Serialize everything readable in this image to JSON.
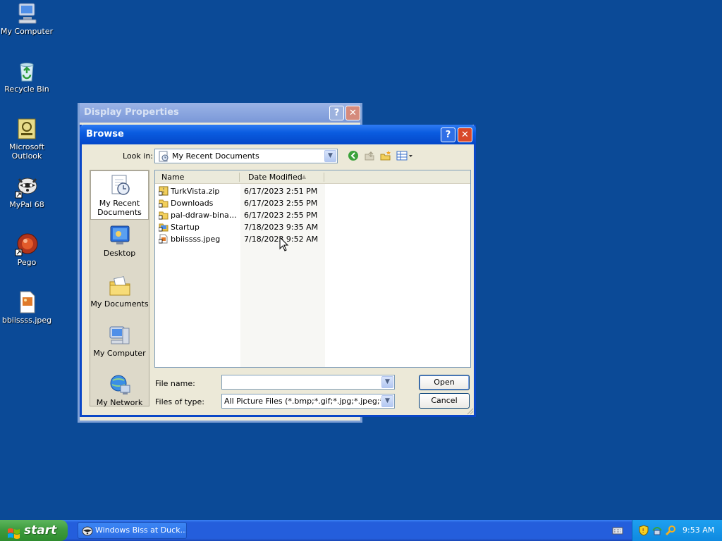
{
  "desktop": {
    "icons": [
      {
        "label": "My Computer"
      },
      {
        "label": "Recycle Bin"
      },
      {
        "label": "Microsoft Outlook"
      },
      {
        "label": "MyPal 68"
      },
      {
        "label": "Pego"
      },
      {
        "label": "bbiissss.jpeg"
      }
    ]
  },
  "bg_window": {
    "title": "Display Properties",
    "help": "?",
    "close": "✕"
  },
  "dialog": {
    "title": "Browse",
    "help": "?",
    "close": "✕",
    "look_in_label": "Look in:",
    "look_in_value": "My Recent Documents",
    "places": [
      {
        "label": "My Recent Documents",
        "icon": "recent-documents-icon"
      },
      {
        "label": "Desktop",
        "icon": "desktop-icon"
      },
      {
        "label": "My Documents",
        "icon": "my-documents-icon"
      },
      {
        "label": "My Computer",
        "icon": "my-computer-icon"
      },
      {
        "label": "My Network",
        "icon": "my-network-icon"
      }
    ],
    "columns": {
      "name": "Name",
      "date": "Date Modified"
    },
    "files": [
      {
        "name": "TurkVista.zip",
        "date": "6/17/2023 2:51 PM",
        "icon": "zip-shortcut-icon"
      },
      {
        "name": "Downloads",
        "date": "6/17/2023 2:55 PM",
        "icon": "folder-shortcut-icon"
      },
      {
        "name": "pal-ddraw-binary...",
        "date": "6/17/2023 2:55 PM",
        "icon": "folder-shortcut-icon"
      },
      {
        "name": "Startup",
        "date": "7/18/2023 9:35 AM",
        "icon": "folder-shortcut-icon"
      },
      {
        "name": "bbiissss.jpeg",
        "date": "7/18/2023 9:52 AM",
        "icon": "image-shortcut-icon"
      }
    ],
    "file_name_label": "File name:",
    "file_name_value": "",
    "file_type_label": "Files of type:",
    "file_type_value": "All Picture Files (*.bmp;*.gif;*.jpg;*.jpeg;*.dib;*.pr",
    "open_label": "Open",
    "cancel_label": "Cancel"
  },
  "taskbar": {
    "start_label": "start",
    "task_label": "Windows Biss at Duck...",
    "clock": "9:53 AM"
  }
}
